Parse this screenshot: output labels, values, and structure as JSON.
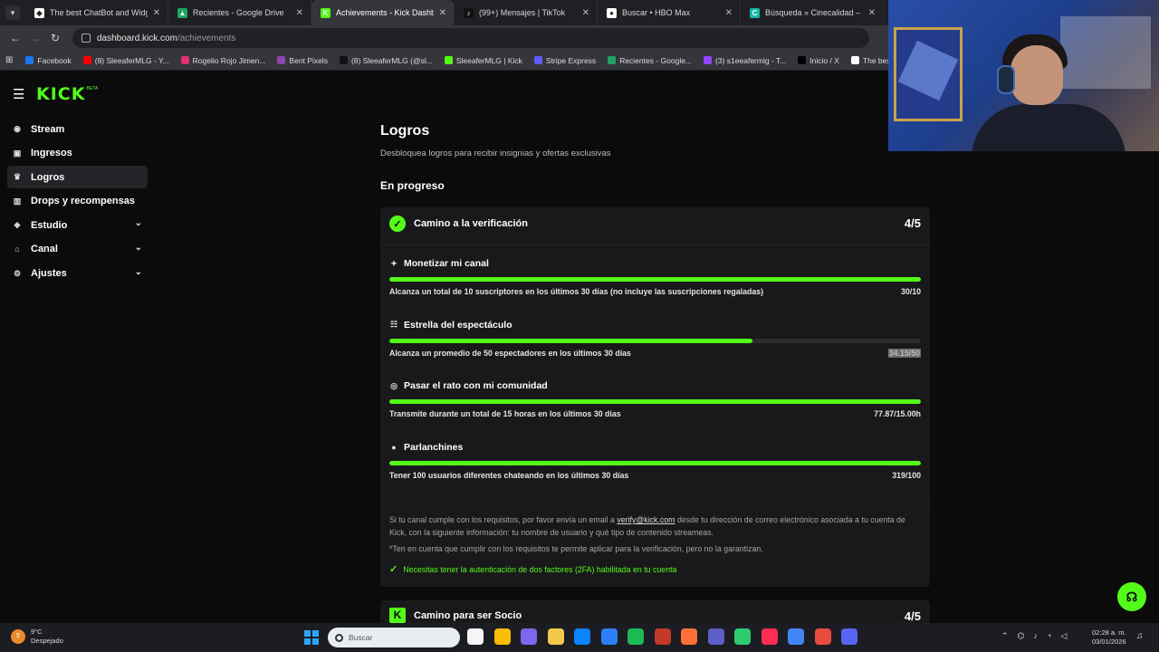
{
  "browser": {
    "tabs": [
      {
        "title": "The best ChatBot and Widgets",
        "fav": "#ffffff",
        "glyph": "◆"
      },
      {
        "title": "Recientes - Google Drive",
        "fav": "#1fa463",
        "glyph": "▲"
      },
      {
        "title": "Achievements - Kick Dashboard",
        "fav": "#53fc18",
        "glyph": "K",
        "active": true
      },
      {
        "title": "(99+) Mensajes | TikTok",
        "fav": "#111111",
        "glyph": "♪"
      },
      {
        "title": "Buscar • HBO Max",
        "fav": "#ffffff",
        "glyph": "●"
      },
      {
        "title": "Búsqueda » Cinecalidad – Pelíc",
        "fav": "#14b8a6",
        "glyph": "C"
      }
    ],
    "url_host": "dashboard.kick.com",
    "url_path": "/achievements",
    "bookmarks": [
      {
        "label": "Facebook",
        "color": "#1877f2"
      },
      {
        "label": "(8) SleeaferMLG - Y...",
        "color": "#ff0000"
      },
      {
        "label": "Rogelio Rojo Jimen...",
        "color": "#e1306c"
      },
      {
        "label": "Bent Pixels",
        "color": "#8e44ad"
      },
      {
        "label": "(8) SleeaferMLG (@sl...",
        "color": "#111111"
      },
      {
        "label": "SleeaferMLG | Kick",
        "color": "#53fc18"
      },
      {
        "label": "Stripe Express",
        "color": "#635bff"
      },
      {
        "label": "Recientes - Google...",
        "color": "#1fa463"
      },
      {
        "label": "(3) s1eeafermlg - T...",
        "color": "#9146ff"
      },
      {
        "label": "Inicio / X",
        "color": "#000000"
      },
      {
        "label": "The best ChatBot an",
        "color": "#ffffff"
      }
    ]
  },
  "app": {
    "logo": "KICK",
    "beta": "BETA",
    "sidebar": [
      {
        "label": "Stream",
        "icon": "◉",
        "name": "stream"
      },
      {
        "label": "Ingresos",
        "icon": "▣",
        "name": "ingresos"
      },
      {
        "label": "Logros",
        "icon": "♛",
        "name": "logros",
        "active": true
      },
      {
        "label": "Drops y recompensas",
        "icon": "▥",
        "name": "drops"
      },
      {
        "label": "Estudio",
        "icon": "◈",
        "name": "estudio",
        "chevron": true
      },
      {
        "label": "Canal",
        "icon": "⌂",
        "name": "canal",
        "chevron": true
      },
      {
        "label": "Ajustes",
        "icon": "⚙",
        "name": "ajustes",
        "chevron": true
      }
    ]
  },
  "page": {
    "title": "Logros",
    "subtitle": "Desbloquea logros para recibir insignias y ofertas exclusivas",
    "section": "En progreso",
    "card": {
      "title": "Camino a la verificación",
      "count": "4/5",
      "achievements": [
        {
          "title": "Monetizar mi canal",
          "icon": "✦",
          "progress": 100,
          "desc": "Alcanza un total de 10 suscriptores en los últimos 30 días (no incluye las suscripciones regaladas)",
          "value": "30/10"
        },
        {
          "title": "Estrella del espectáculo",
          "icon": "☷",
          "progress": 68.3,
          "desc": "Alcanza un promedio de 50 espectadores en los últimos 30 días",
          "value": "34.15/50",
          "highlight": true
        },
        {
          "title": "Pasar el rato con mi comunidad",
          "icon": "◎",
          "progress": 100,
          "desc": "Transmite durante un total de 15 horas en los últimos 30 días",
          "value": "77.87/15.00h"
        },
        {
          "title": "Parlanchines",
          "icon": "●",
          "progress": 100,
          "desc": "Tener 100 usuarios diferentes chateando en los últimos 30 días",
          "value": "319/100"
        }
      ],
      "note_before": "Si tu canal cumple con los requisitos, por favor envía un email a ",
      "note_email": "verify@kick.com",
      "note_after": " desde tu dirección de correo electrónico asociada a tu cuenta de Kick, con la siguiente información: tu nombre de usuario y qué tipo de contenido streameas.",
      "note2": "*Ten en cuenta que cumplir con los requisitos te permite aplicar para la verificación, pero no la garantizan.",
      "check": "Necesitas tener la autenticación de dos factores (2FA) habilitada en tu cuenta"
    },
    "card2": {
      "title": "Camino para ser Socio",
      "count": "4/5"
    }
  },
  "taskbar": {
    "temp": "9°C",
    "weather": "Despejado",
    "weather_badge": "5",
    "search_placeholder": "Buscar",
    "time": "02:28 a. m.",
    "date": "03/01/2026",
    "apps": [
      "#f5f5f5",
      "#fbbc05",
      "#7b68ee",
      "#f2c94c",
      "#0a84ff",
      "#2d7ff9",
      "#1db954",
      "#c0392b",
      "#ff7139",
      "#5b5fc7",
      "#2ecc71",
      "#ff2d55",
      "#4285f4",
      "#e74c3c",
      "#5865f2"
    ]
  }
}
